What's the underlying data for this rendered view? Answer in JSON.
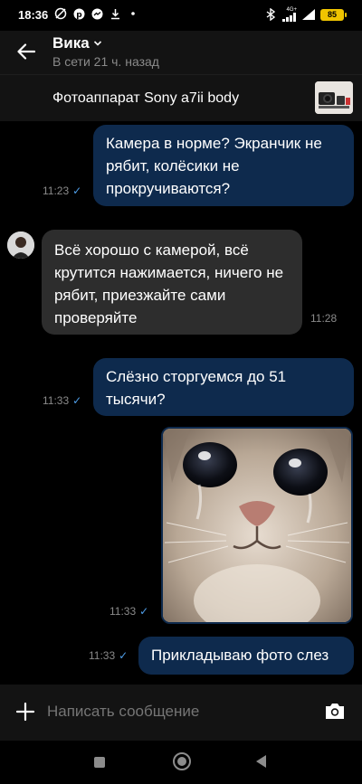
{
  "status_bar": {
    "time": "18:36",
    "network": "4G+",
    "battery": "85"
  },
  "header": {
    "contact_name": "Вика",
    "contact_status": "В сети 21 ч. назад"
  },
  "product": {
    "title": "Фотоаппарат Sony a7ii body"
  },
  "messages": [
    {
      "direction": "out",
      "text": "Камера в норме? Экранчик не рябит, колёсики не прокручиваются?",
      "time": "11:23"
    },
    {
      "direction": "in",
      "text": "Всё хорошо с камерой, всё крутится нажимается, ничего не рябит, приезжайте сами проверяйте",
      "time": "11:28"
    },
    {
      "direction": "out",
      "text": "Слёзно сторгуемся до 51 тысячи?",
      "time": "11:33"
    },
    {
      "direction": "out",
      "type": "image",
      "image": "crying-cat-photo",
      "time": "11:33"
    },
    {
      "direction": "out",
      "text": "Прикладываю фото слез",
      "time": "11:33"
    }
  ],
  "composer": {
    "placeholder": "Написать сообщение"
  },
  "colors": {
    "outgoing_bubble": "#0e2a4d",
    "incoming_bubble": "#2d2d2d",
    "read_check": "#4f9ee8",
    "battery": "#f0c400"
  }
}
